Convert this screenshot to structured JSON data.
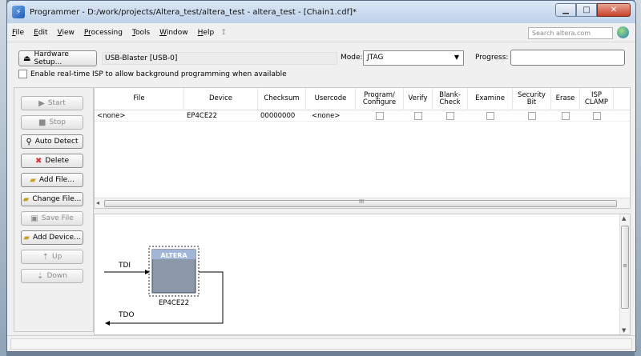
{
  "window": {
    "title": "Programmer - D:/work/projects/Altera_test/altera_test - altera_test - [Chain1.cdf]*",
    "min": "▁",
    "max": "□",
    "close": "✕"
  },
  "menu": {
    "items": [
      {
        "key": "File",
        "label": "ile",
        "u": "F"
      },
      {
        "key": "Edit",
        "label": "dit",
        "u": "E"
      },
      {
        "key": "View",
        "label": "iew",
        "u": "V"
      },
      {
        "key": "Processing",
        "label": "ocessing",
        "u": "Pr"
      },
      {
        "key": "Tools",
        "label": "ools",
        "u": "T"
      },
      {
        "key": "Window",
        "label": "indow",
        "u": "W"
      },
      {
        "key": "Help",
        "label": "elp",
        "u": "H"
      }
    ],
    "search_placeholder": "Search altera.com"
  },
  "toolbar": {
    "hardware_setup_label": "Hardware Setup...",
    "hardware_value": "USB-Blaster [USB-0]",
    "mode_label": "Mode:",
    "mode_value": "JTAG",
    "progress_label": "Progress:",
    "isp_label": "Enable real-time ISP to allow background programming when available"
  },
  "side_buttons": {
    "start": "Start",
    "stop": "Stop",
    "auto_detect": "Auto Detect",
    "delete": "Delete",
    "add_file": "Add File...",
    "change_file": "Change File...",
    "save_file": "Save File",
    "add_device": "Add Device...",
    "up": "Up",
    "down": "Down"
  },
  "table": {
    "headers": {
      "file": "File",
      "device": "Device",
      "checksum": "Checksum",
      "usercode": "Usercode",
      "program_configure": "Program/ Configure",
      "verify": "Verify",
      "blank_check": "Blank- Check",
      "examine": "Examine",
      "security_bit": "Security Bit",
      "erase": "Erase",
      "isp_clamp": "ISP CLAMP"
    },
    "row": {
      "file": "<none>",
      "device": "EP4CE22",
      "checksum": "00000000",
      "usercode": "<none>"
    },
    "scroll_grip": "III"
  },
  "diagram": {
    "tdi": "TDI",
    "tdo": "TDO",
    "chip_name": "EP4CE22",
    "chip_logo": "ALTERA",
    "scroll_grip": "≡"
  }
}
